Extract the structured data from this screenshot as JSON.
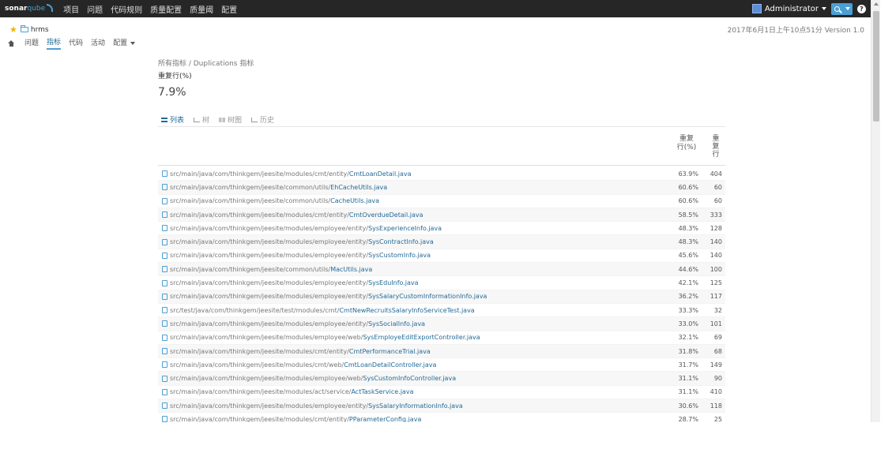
{
  "navbar": {
    "logo_part1": "sonar",
    "logo_part2": "qube",
    "items": [
      "项目",
      "问题",
      "代码规则",
      "质量配置",
      "质量阈",
      "配置"
    ],
    "user": "Administrator"
  },
  "context": {
    "project": "hrms",
    "meta": "2017年6月1日上午10点51分  Version 1.0",
    "tabs": [
      "问题",
      "指标",
      "代码",
      "活动",
      "配置"
    ],
    "active_tab": "指标"
  },
  "main": {
    "breadcrumb": "所有指标 / Duplications 指标",
    "metric_name": "重复行(%)",
    "metric_value": "7.9%",
    "view_tabs": [
      "列表",
      "树",
      "树图",
      "历史"
    ],
    "col_dup_pct": "重复行(%)",
    "col_dup_lines": "重复行"
  },
  "rows": [
    {
      "path": "src/main/java/com/thinkgem/jeesite/modules/cmt/entity/",
      "file": "CmtLoanDetail.java",
      "pct": "63.9%",
      "lines": "404"
    },
    {
      "path": "src/main/java/com/thinkgem/jeesite/common/utils/",
      "file": "EhCacheUtils.java",
      "pct": "60.6%",
      "lines": "60"
    },
    {
      "path": "src/main/java/com/thinkgem/jeesite/common/utils/",
      "file": "CacheUtils.java",
      "pct": "60.6%",
      "lines": "60"
    },
    {
      "path": "src/main/java/com/thinkgem/jeesite/modules/cmt/entity/",
      "file": "CmtOverdueDetail.java",
      "pct": "58.5%",
      "lines": "333"
    },
    {
      "path": "src/main/java/com/thinkgem/jeesite/modules/employee/entity/",
      "file": "SysExperienceInfo.java",
      "pct": "48.3%",
      "lines": "128"
    },
    {
      "path": "src/main/java/com/thinkgem/jeesite/modules/employee/entity/",
      "file": "SysContractInfo.java",
      "pct": "48.3%",
      "lines": "140"
    },
    {
      "path": "src/main/java/com/thinkgem/jeesite/modules/employee/entity/",
      "file": "SysCustomInfo.java",
      "pct": "45.6%",
      "lines": "140"
    },
    {
      "path": "src/main/java/com/thinkgem/jeesite/common/utils/",
      "file": "MacUtils.java",
      "pct": "44.6%",
      "lines": "100"
    },
    {
      "path": "src/main/java/com/thinkgem/jeesite/modules/employee/entity/",
      "file": "SysEduInfo.java",
      "pct": "42.1%",
      "lines": "125"
    },
    {
      "path": "src/main/java/com/thinkgem/jeesite/modules/employee/entity/",
      "file": "SysSalaryCustomInformationInfo.java",
      "pct": "36.2%",
      "lines": "117"
    },
    {
      "path": "src/test/java/com/thinkgem/jeesite/test/modules/cmt/",
      "file": "CmtNewRecruitsSalaryInfoServiceTest.java",
      "pct": "33.3%",
      "lines": "32"
    },
    {
      "path": "src/main/java/com/thinkgem/jeesite/modules/employee/entity/",
      "file": "SysSocialInfo.java",
      "pct": "33.0%",
      "lines": "101"
    },
    {
      "path": "src/main/java/com/thinkgem/jeesite/modules/employee/web/",
      "file": "SysEmployeEditExportController.java",
      "pct": "32.1%",
      "lines": "69"
    },
    {
      "path": "src/main/java/com/thinkgem/jeesite/modules/cmt/entity/",
      "file": "CmtPerformanceTrial.java",
      "pct": "31.8%",
      "lines": "68"
    },
    {
      "path": "src/main/java/com/thinkgem/jeesite/modules/cmt/web/",
      "file": "CmtLoanDetailController.java",
      "pct": "31.7%",
      "lines": "149"
    },
    {
      "path": "src/main/java/com/thinkgem/jeesite/modules/employee/web/",
      "file": "SysCustomInfoController.java",
      "pct": "31.1%",
      "lines": "90"
    },
    {
      "path": "src/main/java/com/thinkgem/jeesite/modules/act/service/",
      "file": "ActTaskService.java",
      "pct": "31.1%",
      "lines": "410"
    },
    {
      "path": "src/main/java/com/thinkgem/jeesite/modules/employee/entity/",
      "file": "SysSalaryInformationInfo.java",
      "pct": "30.6%",
      "lines": "118"
    },
    {
      "path": "src/main/java/com/thinkgem/jeesite/modules/cmt/entity/",
      "file": "PParameterConfig.java",
      "pct": "28.7%",
      "lines": "25"
    }
  ]
}
